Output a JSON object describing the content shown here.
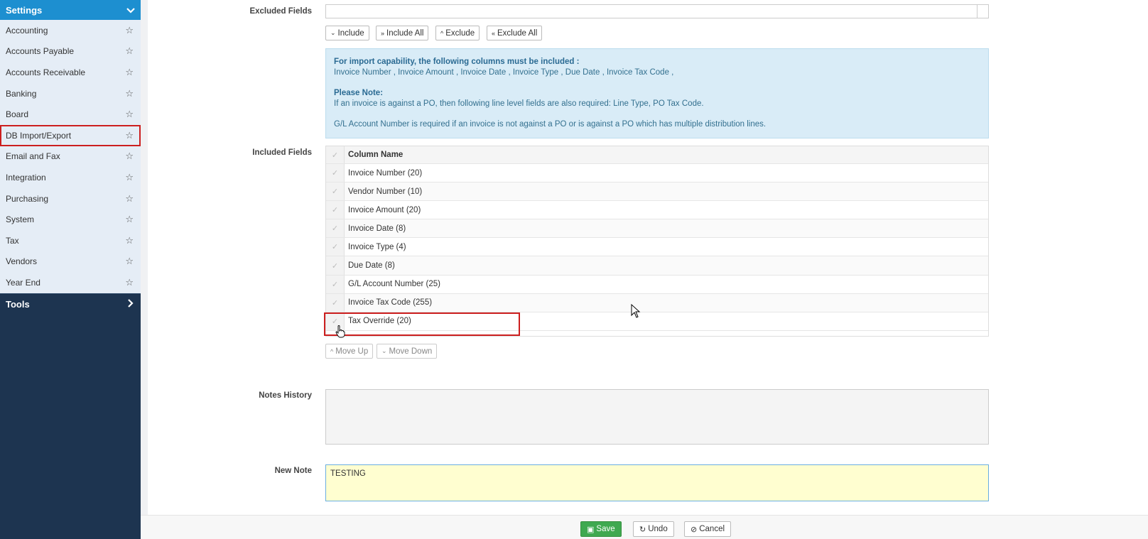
{
  "sidebar": {
    "settings_title": "Settings",
    "items": [
      {
        "label": "Accounting"
      },
      {
        "label": "Accounts Payable"
      },
      {
        "label": "Accounts Receivable"
      },
      {
        "label": "Banking"
      },
      {
        "label": "Board"
      },
      {
        "label": "DB Import/Export"
      },
      {
        "label": "Email and Fax"
      },
      {
        "label": "Integration"
      },
      {
        "label": "Purchasing"
      },
      {
        "label": "System"
      },
      {
        "label": "Tax"
      },
      {
        "label": "Vendors"
      },
      {
        "label": "Year End"
      }
    ],
    "tools_title": "Tools"
  },
  "form": {
    "excluded_label": "Excluded Fields",
    "buttons": {
      "include": "Include",
      "include_all": "Include All",
      "exclude": "Exclude",
      "exclude_all": "Exclude All"
    },
    "info": {
      "heading": "For import capability, the following columns must be included :",
      "required_columns": "Invoice Number , Invoice Amount , Invoice Date , Invoice Type , Due Date , Invoice Tax Code ,",
      "note_heading": "Please Note:",
      "note_line1": "If an invoice is against a PO, then following line level fields are also required: Line Type, PO Tax Code.",
      "note_line2": "G/L Account Number is required if an invoice is not against a PO or is against a PO which has multiple distribution lines."
    },
    "included_label": "Included Fields",
    "grid": {
      "header": "Column Name",
      "rows": [
        "Invoice Number (20)",
        "Vendor Number (10)",
        "Invoice Amount (20)",
        "Invoice Date (8)",
        "Invoice Type (4)",
        "Due Date (8)",
        "G/L Account Number (25)",
        "Invoice Tax Code (255)",
        "Tax Override (20)"
      ]
    },
    "move_up": "Move Up",
    "move_down": "Move Down",
    "notes_history_label": "Notes History",
    "new_note_label": "New Note",
    "new_note_value": "TESTING"
  },
  "footer": {
    "save": "Save",
    "undo": "Undo",
    "cancel": "Cancel"
  },
  "colors": {
    "sidebar_dark": "#1d3450",
    "settings_blue": "#1d8fd0",
    "highlight_red": "#cc1f1f",
    "save_green": "#3fa950"
  }
}
